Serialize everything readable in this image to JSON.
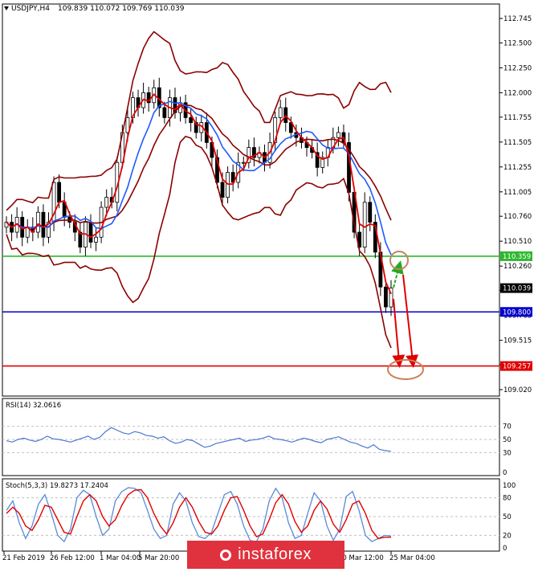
{
  "chart_data": {
    "type": "candlestick",
    "header": {
      "symbol": "USDJPY,H4",
      "ohlc": "109.839 110.072 109.769 110.039"
    },
    "y_ticks": [
      "112.745",
      "112.500",
      "112.250",
      "112.000",
      "111.755",
      "111.505",
      "111.255",
      "111.005",
      "110.760",
      "110.510",
      "110.260",
      "110.015",
      "109.765",
      "109.515",
      "109.270",
      "109.020"
    ],
    "ylim": [
      109.02,
      112.745
    ],
    "x_ticks": [
      "21 Feb 2019",
      "26 Feb 12:00",
      "1 Mar 04:00",
      "5 Mar 20:00",
      "20 Mar 12:00",
      "25 Mar 04:00"
    ],
    "price_labels": [
      {
        "text": "110.359",
        "value": 110.359,
        "color": "#2eb82e"
      },
      {
        "text": "110.039",
        "value": 110.039,
        "color": "#000000"
      },
      {
        "text": "109.800",
        "value": 109.8,
        "color": "#0000cc"
      },
      {
        "text": "109.257",
        "value": 109.257,
        "color": "#e00000"
      }
    ],
    "levels": [
      {
        "value": 110.359,
        "color": "#2eb82e"
      },
      {
        "value": 109.8,
        "color": "#0000cc"
      },
      {
        "value": 109.257,
        "color": "#e00000"
      }
    ],
    "closes": [
      110.7,
      110.6,
      110.75,
      110.55,
      110.65,
      110.6,
      110.8,
      110.55,
      110.7,
      111.1,
      110.9,
      110.75,
      110.7,
      110.6,
      110.45,
      110.7,
      110.5,
      110.55,
      110.85,
      110.95,
      110.9,
      111.3,
      111.6,
      111.75,
      111.95,
      111.85,
      112.0,
      111.9,
      112.05,
      111.85,
      111.75,
      111.95,
      111.8,
      111.9,
      111.75,
      111.7,
      111.6,
      111.7,
      111.5,
      111.35,
      111.1,
      110.95,
      111.2,
      111.1,
      111.3,
      111.3,
      111.45,
      111.35,
      111.4,
      111.3,
      111.5,
      111.75,
      111.85,
      111.7,
      111.6,
      111.55,
      111.5,
      111.45,
      111.4,
      111.25,
      111.35,
      111.45,
      111.55,
      111.6,
      111.5,
      111.0,
      110.6,
      110.45,
      110.9,
      110.7,
      110.4,
      110.05,
      109.85,
      110.04
    ],
    "rsi": {
      "label": "RSI(14) 32.0616",
      "ticks": [
        "70",
        "50",
        "30",
        "0"
      ],
      "ylim": [
        0,
        100
      ],
      "values": [
        48,
        46,
        50,
        52,
        49,
        47,
        50,
        55,
        51,
        50,
        48,
        46,
        49,
        52,
        55,
        50,
        53,
        62,
        68,
        64,
        60,
        58,
        62,
        60,
        56,
        55,
        52,
        54,
        48,
        44,
        46,
        50,
        48,
        43,
        38,
        40,
        44,
        46,
        48,
        50,
        52,
        47,
        49,
        50,
        52,
        55,
        51,
        50,
        48,
        46,
        49,
        52,
        50,
        47,
        45,
        50,
        52,
        54,
        50,
        46,
        44,
        40,
        37,
        42,
        35,
        33,
        32
      ]
    },
    "stoch": {
      "label": "Stoch(5,3,3) 19.8273 17.2404",
      "ticks": [
        "100",
        "80",
        "50",
        "20",
        "0"
      ],
      "ylim": [
        0,
        100
      ],
      "k": [
        60,
        75,
        40,
        15,
        35,
        70,
        85,
        55,
        20,
        10,
        30,
        80,
        92,
        85,
        50,
        20,
        30,
        75,
        90,
        96,
        95,
        88,
        60,
        30,
        15,
        20,
        70,
        88,
        75,
        40,
        18,
        15,
        25,
        55,
        85,
        90,
        70,
        35,
        12,
        10,
        30,
        75,
        95,
        80,
        40,
        15,
        20,
        55,
        88,
        75,
        35,
        12,
        30,
        82,
        90,
        60,
        20,
        10,
        15,
        20,
        19
      ],
      "d": [
        55,
        65,
        55,
        35,
        28,
        45,
        68,
        65,
        45,
        25,
        22,
        50,
        75,
        85,
        75,
        50,
        35,
        45,
        68,
        85,
        92,
        93,
        80,
        55,
        35,
        22,
        40,
        65,
        80,
        65,
        42,
        25,
        22,
        35,
        60,
        80,
        82,
        60,
        35,
        18,
        22,
        45,
        72,
        85,
        70,
        42,
        25,
        35,
        60,
        75,
        62,
        38,
        25,
        45,
        70,
        75,
        55,
        28,
        15,
        17,
        17
      ]
    },
    "annotations": [
      "green-up-arrow",
      "red-down-arrow-1",
      "red-down-arrow-2",
      "orange-ellipse-top",
      "orange-ellipse-bottom"
    ]
  },
  "watermark": {
    "text": "instaforex"
  }
}
